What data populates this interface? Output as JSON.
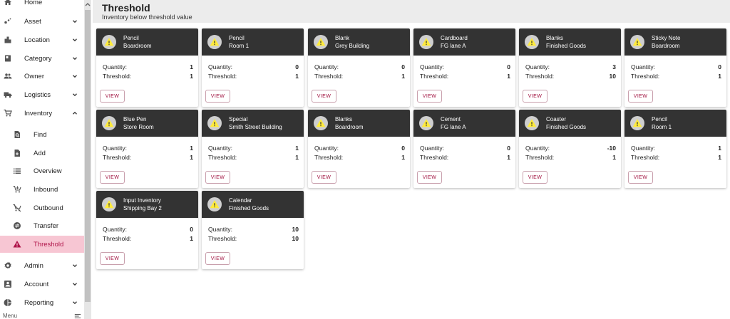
{
  "sidebar": {
    "items": [
      {
        "label": "Home",
        "icon": "home-icon"
      },
      {
        "label": "Asset",
        "icon": "asset-icon"
      },
      {
        "label": "Location",
        "icon": "location-icon"
      },
      {
        "label": "Category",
        "icon": "category-icon"
      },
      {
        "label": "Owner",
        "icon": "owner-icon"
      },
      {
        "label": "Logistics",
        "icon": "truck-icon"
      },
      {
        "label": "Inventory",
        "icon": "cart-icon"
      }
    ],
    "inventory_sub": [
      {
        "label": "Find",
        "icon": "find-icon"
      },
      {
        "label": "Add",
        "icon": "add-icon"
      },
      {
        "label": "Overview",
        "icon": "list-icon"
      },
      {
        "label": "Inbound",
        "icon": "inbound-icon"
      },
      {
        "label": "Outbound",
        "icon": "outbound-icon"
      },
      {
        "label": "Transfer",
        "icon": "transfer-icon"
      },
      {
        "label": "Threshold",
        "icon": "warning-icon"
      }
    ],
    "bottom_items": [
      {
        "label": "Admin",
        "icon": "gear-icon"
      },
      {
        "label": "Account",
        "icon": "account-icon"
      },
      {
        "label": "Reporting",
        "icon": "pie-icon"
      }
    ],
    "footer": "Menu",
    "active_color": "#f7c6d3"
  },
  "header": {
    "title": "Threshold",
    "subtitle": "Inventory below threshold value"
  },
  "labels": {
    "quantity": "Quantity:",
    "threshold": "Threshold:",
    "view": "VIEW"
  },
  "cards": [
    {
      "name": "Pencil",
      "location": "Boardroom",
      "quantity": "1",
      "threshold": "1"
    },
    {
      "name": "Pencil",
      "location": "Room 1",
      "quantity": "0",
      "threshold": "1"
    },
    {
      "name": "Blank",
      "location": "Grey Building",
      "quantity": "0",
      "threshold": "1"
    },
    {
      "name": "Cardboard",
      "location": "FG lane A",
      "quantity": "0",
      "threshold": "1"
    },
    {
      "name": "Blanks",
      "location": "Finished Goods",
      "quantity": "3",
      "threshold": "10"
    },
    {
      "name": "Sticky Note",
      "location": "Boardroom",
      "quantity": "0",
      "threshold": "1"
    },
    {
      "name": "Blue Pen",
      "location": "Store Room",
      "quantity": "1",
      "threshold": "1"
    },
    {
      "name": "Special",
      "location": "Smith Street Building",
      "quantity": "1",
      "threshold": "1"
    },
    {
      "name": "Blanks",
      "location": "Boardroom",
      "quantity": "0",
      "threshold": "1"
    },
    {
      "name": "Cement",
      "location": "FG lane A",
      "quantity": "0",
      "threshold": "1"
    },
    {
      "name": "Coaster",
      "location": "Finished Goods",
      "quantity": "-10",
      "threshold": "1"
    },
    {
      "name": "Pencil",
      "location": "Room 1",
      "quantity": "1",
      "threshold": "1"
    },
    {
      "name": "Input Inventory",
      "location": "Shipping Bay 2",
      "quantity": "0",
      "threshold": "1"
    },
    {
      "name": "Calendar",
      "location": "Finished Goods",
      "quantity": "10",
      "threshold": "10"
    }
  ],
  "colors": {
    "card_header": "#333333",
    "warning_yellow": "#ffeb3b",
    "accent": "#a0103e"
  }
}
